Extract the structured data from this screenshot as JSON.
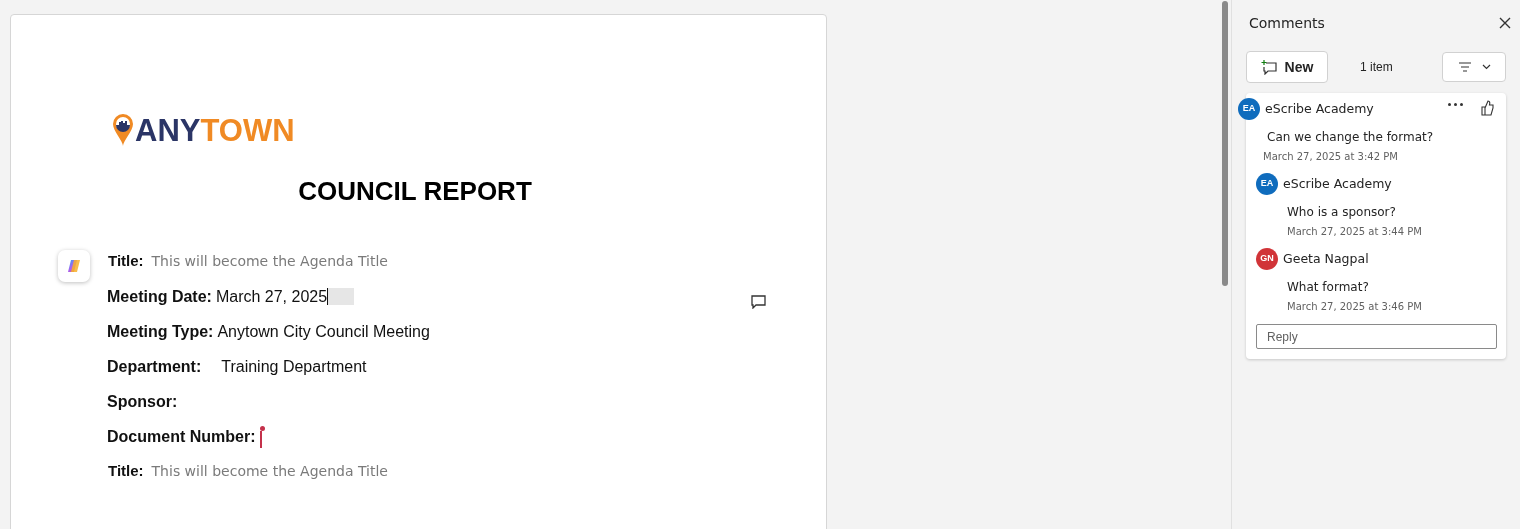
{
  "document": {
    "logo": [
      {
        "text": "ANY",
        "color": "#2b3566"
      },
      {
        "text": "TOWN",
        "color": "#f08a24"
      }
    ],
    "heading": "COUNCIL REPORT",
    "fields": [
      {
        "kind": "placeholder",
        "label": "Title:",
        "placeholder": "This will become the Agenda Title"
      },
      {
        "kind": "date",
        "label": "Meeting Date:",
        "value": "March 27, 2025"
      },
      {
        "kind": "value",
        "label": "Meeting Type:",
        "value": "Anytown City Council Meeting"
      },
      {
        "kind": "tabbed",
        "label": "Department:",
        "value": "Training Department"
      },
      {
        "kind": "empty",
        "label": "Sponsor:"
      },
      {
        "kind": "cursor",
        "label": "Document Number:"
      },
      {
        "kind": "placeholder",
        "label": "Title:",
        "placeholder": "This will become the Agenda Title"
      }
    ]
  },
  "comments_pane": {
    "title": "Comments",
    "new_button": "New",
    "count": "1 item",
    "thread": [
      {
        "initials": "EA",
        "author": "eScribe Academy",
        "color": "#0f6cbd",
        "text": "Can we change the format?",
        "time": "March 27, 2025 at 3:42 PM"
      },
      {
        "initials": "EA",
        "author": "eScribe Academy",
        "color": "#0f6cbd",
        "text": "Who is a sponsor?",
        "time": "March 27, 2025 at 3:44 PM"
      },
      {
        "initials": "GN",
        "author": "Geeta Nagpal",
        "color": "#d13438",
        "text": "What format?",
        "time": "March 27, 2025 at 3:46 PM"
      }
    ],
    "reply": {
      "placeholder": "Reply"
    }
  }
}
